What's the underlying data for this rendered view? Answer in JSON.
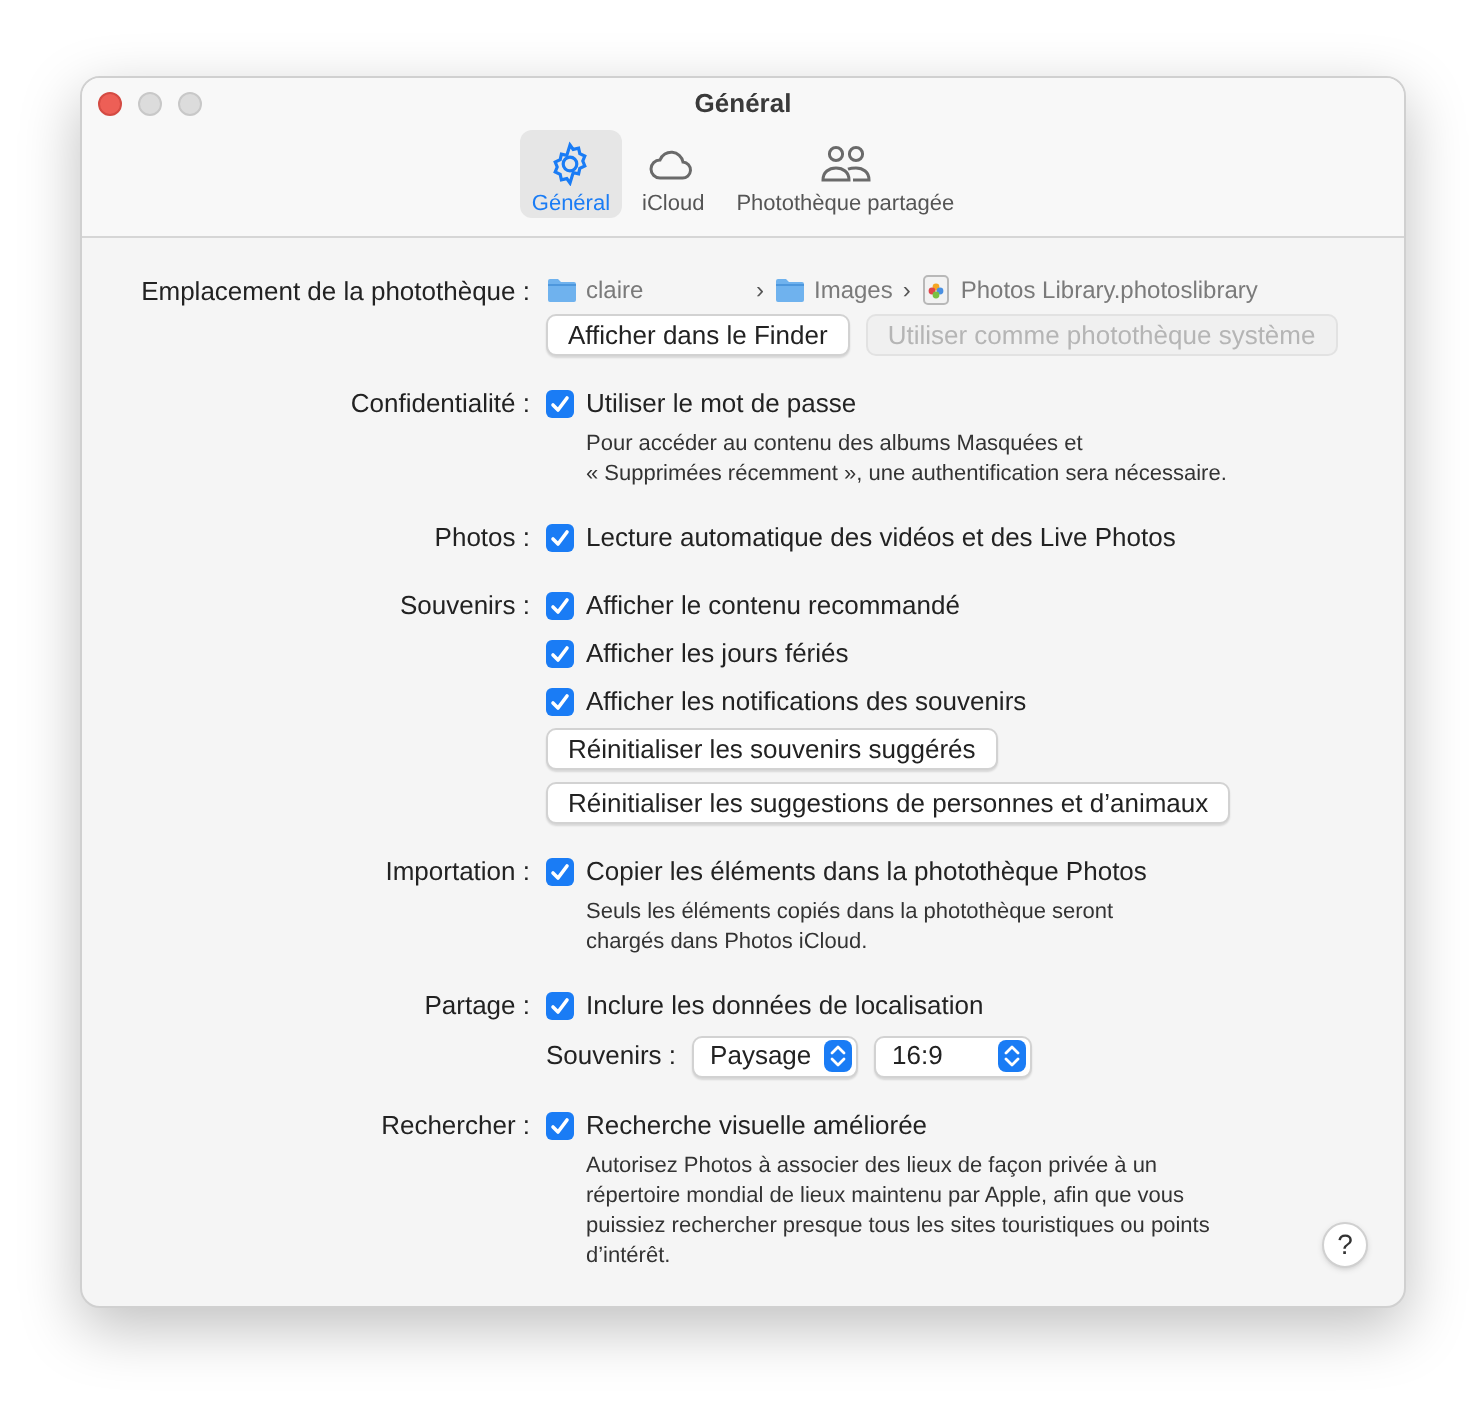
{
  "window": {
    "title": "Général"
  },
  "toolbar": [
    {
      "label": "Général",
      "kind": "gear",
      "selected": true
    },
    {
      "label": "iCloud",
      "kind": "cloud",
      "selected": false
    },
    {
      "label": "Photothèque partagée",
      "kind": "people",
      "selected": false
    }
  ],
  "sections": [
    {
      "label": "Emplacement de la photothèque :",
      "items": [
        {
          "kind": "path",
          "parts": [
            {
              "kind": "folder",
              "text": "claire"
            },
            {
              "kind": "separator",
              "text": "›"
            },
            {
              "kind": "folder",
              "text": "Images"
            },
            {
              "kind": "separator",
              "text": "›"
            },
            {
              "kind": "library",
              "text": "Photos Library.photoslibrary"
            }
          ]
        },
        {
          "kind": "buttons",
          "buttons": [
            {
              "label": "Afficher dans le Finder",
              "disabled": false
            },
            {
              "label": "Utiliser comme photothèque système",
              "disabled": true
            }
          ]
        }
      ]
    },
    {
      "label": "Confidentialité :",
      "items": [
        {
          "kind": "checkbox",
          "label": "Utiliser le mot de passe",
          "checked": true,
          "note": [
            "Pour accéder au contenu des albums Masquées et",
            "« Supprimées récemment », une authentification sera nécessaire."
          ]
        }
      ]
    },
    {
      "label": "Photos :",
      "items": [
        {
          "kind": "checkbox",
          "label": "Lecture automatique des vidéos et des Live Photos",
          "checked": true
        }
      ]
    },
    {
      "label": "Souvenirs :",
      "items": [
        {
          "kind": "checkbox",
          "label": "Afficher le contenu recommandé",
          "checked": true
        },
        {
          "kind": "checkbox",
          "label": "Afficher les jours fériés",
          "checked": true
        },
        {
          "kind": "checkbox",
          "label": "Afficher les notifications des souvenirs",
          "checked": true
        },
        {
          "kind": "buttons",
          "buttons": [
            {
              "label": "Réinitialiser les souvenirs suggérés",
              "disabled": false
            }
          ]
        },
        {
          "kind": "buttons",
          "buttons": [
            {
              "label": "Réinitialiser les suggestions de personnes et d’animaux",
              "disabled": false
            }
          ]
        }
      ]
    },
    {
      "label": "Importation :",
      "items": [
        {
          "kind": "checkbox",
          "label": "Copier les éléments dans la photothèque Photos",
          "checked": true,
          "note": [
            "Seuls les éléments copiés dans la photothèque seront",
            "chargés dans Photos iCloud."
          ]
        }
      ]
    },
    {
      "label": "Partage :",
      "items": [
        {
          "kind": "checkbox",
          "label": "Inclure les données de localisation",
          "checked": true
        },
        {
          "kind": "popups",
          "label": "Souvenirs :",
          "popups": [
            {
              "value": "Paysage"
            },
            {
              "value": "16:9"
            }
          ]
        }
      ]
    },
    {
      "label": "Rechercher :",
      "items": [
        {
          "kind": "checkbox",
          "label": "Recherche visuelle améliorée",
          "checked": true,
          "note": [
            "Autorisez Photos à associer des lieux de façon privée à un",
            "répertoire mondial de lieux maintenu par Apple, afin que vous",
            "puissiez rechercher presque tous les sites touristiques ou points",
            "d’intérêt."
          ]
        }
      ]
    }
  ],
  "help": "?"
}
